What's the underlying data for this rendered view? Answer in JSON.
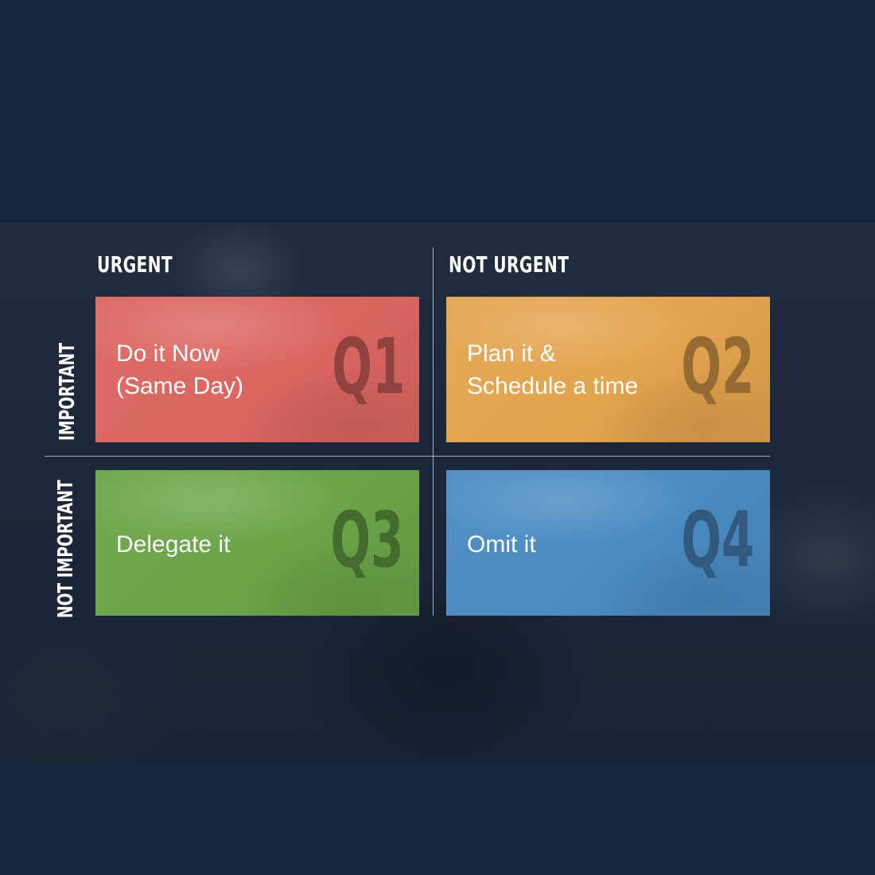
{
  "columns": {
    "urgent": "URGENT",
    "not_urgent": "NOT URGENT"
  },
  "rows": {
    "important": "IMPORTANT",
    "not_important": "NOT IMPORTANT"
  },
  "quadrants": [
    {
      "id": "Q1",
      "text": "Do it Now\n(Same Day)",
      "color": "#dc6660"
    },
    {
      "id": "Q2",
      "text": "Plan it &\nSchedule a time",
      "color": "#e3a44e"
    },
    {
      "id": "Q3",
      "text": "Delegate it",
      "color": "#6aa548"
    },
    {
      "id": "Q4",
      "text": "Omit it",
      "color": "#4b8bc2"
    }
  ],
  "colors": {
    "page_background": "#15253d",
    "divider": "#d2dceb",
    "label_text": "#ffffff"
  }
}
